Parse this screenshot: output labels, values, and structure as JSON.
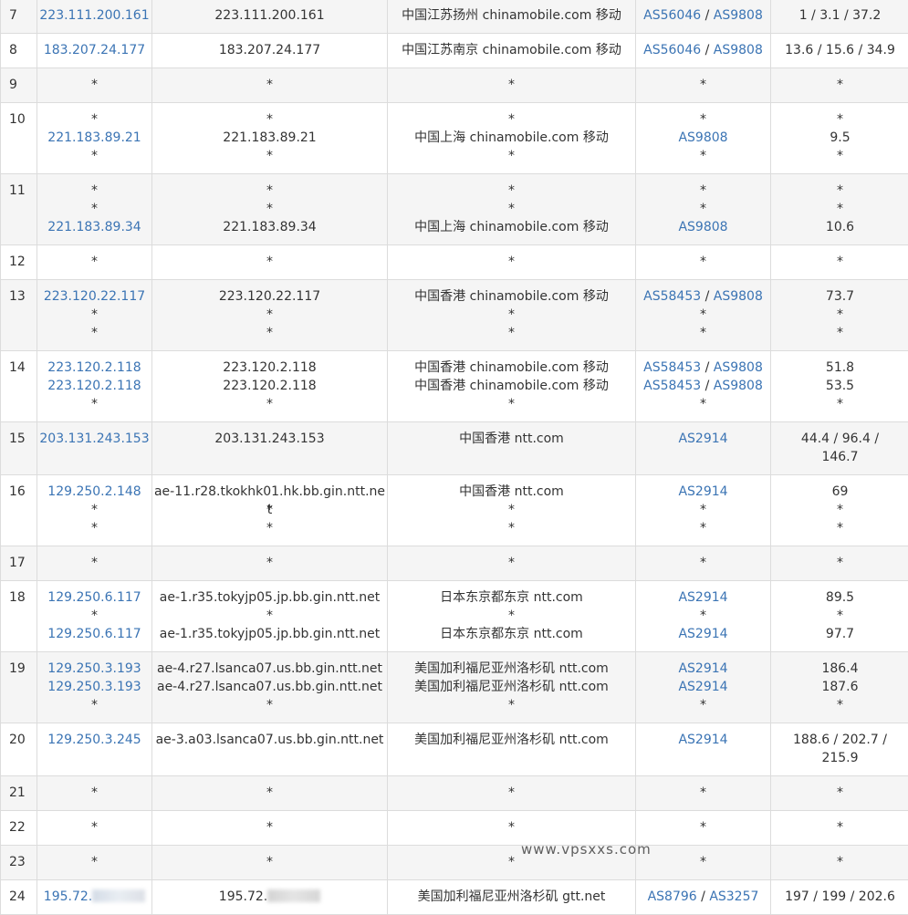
{
  "watermark": "www.vpsxxs.com",
  "rows": [
    {
      "hop": "7",
      "ips": [
        "223.111.200.161"
      ],
      "hosts": [
        "223.111.200.161"
      ],
      "locs": [
        "中国江苏扬州 chinamobile.com 移动"
      ],
      "asns": [
        [
          "AS56046",
          "AS9808"
        ]
      ],
      "times": [
        "1 / 3.1 / 37.2"
      ]
    },
    {
      "hop": "8",
      "ips": [
        "183.207.24.177"
      ],
      "hosts": [
        "183.207.24.177"
      ],
      "locs": [
        "中国江苏南京 chinamobile.com 移动"
      ],
      "asns": [
        [
          "AS56046",
          "AS9808"
        ]
      ],
      "times": [
        "13.6 / 15.6 / 34.9"
      ]
    },
    {
      "hop": "9",
      "ips": [
        "*"
      ],
      "hosts": [
        "*"
      ],
      "locs": [
        "*"
      ],
      "asns": [
        [
          "*"
        ]
      ],
      "times": [
        "*"
      ]
    },
    {
      "hop": "10",
      "ips": [
        "*",
        "221.183.89.21",
        "*"
      ],
      "hosts": [
        "*",
        "221.183.89.21",
        "*"
      ],
      "locs": [
        "*",
        "中国上海 chinamobile.com 移动",
        "*"
      ],
      "asns": [
        [
          "*"
        ],
        [
          "AS9808"
        ],
        [
          "*"
        ]
      ],
      "times": [
        "*",
        "9.5",
        "*"
      ]
    },
    {
      "hop": "11",
      "ips": [
        "*",
        "*",
        "221.183.89.34"
      ],
      "hosts": [
        "*",
        "*",
        "221.183.89.34"
      ],
      "locs": [
        "*",
        "*",
        "中国上海 chinamobile.com 移动"
      ],
      "asns": [
        [
          "*"
        ],
        [
          "*"
        ],
        [
          "AS9808"
        ]
      ],
      "times": [
        "*",
        "*",
        "10.6"
      ]
    },
    {
      "hop": "12",
      "ips": [
        "*"
      ],
      "hosts": [
        "*"
      ],
      "locs": [
        "*"
      ],
      "asns": [
        [
          "*"
        ]
      ],
      "times": [
        "*"
      ]
    },
    {
      "hop": "13",
      "ips": [
        "223.120.22.117",
        "*",
        "*"
      ],
      "hosts": [
        "223.120.22.117",
        "*",
        "*"
      ],
      "locs": [
        "中国香港 chinamobile.com 移动",
        "*",
        "*"
      ],
      "asns": [
        [
          "AS58453",
          "AS9808"
        ],
        [
          "*"
        ],
        [
          "*"
        ]
      ],
      "times": [
        "73.7",
        "*",
        "*"
      ]
    },
    {
      "hop": "14",
      "ips": [
        "223.120.2.118",
        "223.120.2.118",
        "*"
      ],
      "hosts": [
        "223.120.2.118",
        "223.120.2.118",
        "*"
      ],
      "locs": [
        "中国香港 chinamobile.com 移动",
        "中国香港 chinamobile.com 移动",
        "*"
      ],
      "asns": [
        [
          "AS58453",
          "AS9808"
        ],
        [
          "AS58453",
          "AS9808"
        ],
        [
          "*"
        ]
      ],
      "times": [
        "51.8",
        "53.5",
        "*"
      ]
    },
    {
      "hop": "15",
      "ips": [
        "203.131.243.153"
      ],
      "hosts": [
        "203.131.243.153"
      ],
      "locs": [
        "中国香港 ntt.com"
      ],
      "asns": [
        [
          "AS2914"
        ]
      ],
      "times": [
        "44.4 / 96.4 / 146.7"
      ]
    },
    {
      "hop": "16",
      "ips": [
        "129.250.2.148",
        "*",
        "*"
      ],
      "hosts": [
        "ae-11.r28.tkokhk01.hk.bb.gin.ntt.net",
        "*",
        "*"
      ],
      "locs": [
        "中国香港 ntt.com",
        "*",
        "*"
      ],
      "asns": [
        [
          "AS2914"
        ],
        [
          "*"
        ],
        [
          "*"
        ]
      ],
      "times": [
        "69",
        "*",
        "*"
      ]
    },
    {
      "hop": "17",
      "ips": [
        "*"
      ],
      "hosts": [
        "*"
      ],
      "locs": [
        "*"
      ],
      "asns": [
        [
          "*"
        ]
      ],
      "times": [
        "*"
      ]
    },
    {
      "hop": "18",
      "ips": [
        "129.250.6.117",
        "*",
        "129.250.6.117"
      ],
      "hosts": [
        "ae-1.r35.tokyjp05.jp.bb.gin.ntt.net",
        "*",
        "ae-1.r35.tokyjp05.jp.bb.gin.ntt.net"
      ],
      "locs": [
        "日本东京都东京 ntt.com",
        "*",
        "日本东京都东京 ntt.com"
      ],
      "asns": [
        [
          "AS2914"
        ],
        [
          "*"
        ],
        [
          "AS2914"
        ]
      ],
      "times": [
        "89.5",
        "*",
        "97.7"
      ]
    },
    {
      "hop": "19",
      "ips": [
        "129.250.3.193",
        "129.250.3.193",
        "*"
      ],
      "hosts": [
        "ae-4.r27.lsanca07.us.bb.gin.ntt.net",
        "ae-4.r27.lsanca07.us.bb.gin.ntt.net",
        "*"
      ],
      "locs": [
        "美国加利福尼亚州洛杉矶 ntt.com",
        "美国加利福尼亚州洛杉矶 ntt.com",
        "*"
      ],
      "asns": [
        [
          "AS2914"
        ],
        [
          "AS2914"
        ],
        [
          "*"
        ]
      ],
      "times": [
        "186.4",
        "187.6",
        "*"
      ]
    },
    {
      "hop": "20",
      "ips": [
        "129.250.3.245"
      ],
      "hosts": [
        "ae-3.a03.lsanca07.us.bb.gin.ntt.net"
      ],
      "locs": [
        "美国加利福尼亚州洛杉矶 ntt.com"
      ],
      "asns": [
        [
          "AS2914"
        ]
      ],
      "times": [
        "188.6 / 202.7 / 215.9"
      ]
    },
    {
      "hop": "21",
      "ips": [
        "*"
      ],
      "hosts": [
        "*"
      ],
      "locs": [
        "*"
      ],
      "asns": [
        [
          "*"
        ]
      ],
      "times": [
        "*"
      ]
    },
    {
      "hop": "22",
      "ips": [
        "*"
      ],
      "hosts": [
        "*"
      ],
      "locs": [
        "*"
      ],
      "asns": [
        [
          "*"
        ]
      ],
      "times": [
        "*"
      ]
    },
    {
      "hop": "23",
      "ips": [
        "*"
      ],
      "hosts": [
        "*"
      ],
      "locs": [
        "*"
      ],
      "asns": [
        [
          "*"
        ]
      ],
      "times": [
        "*"
      ]
    },
    {
      "hop": "24",
      "ips": [
        "195.72."
      ],
      "hosts": [
        "195.72."
      ],
      "locs": [
        "美国加利福尼亚州洛杉矶 gtt.net"
      ],
      "asns": [
        [
          "AS8796",
          "AS3257"
        ]
      ],
      "times": [
        "197 / 199 / 202.6"
      ],
      "redacted": true
    }
  ]
}
